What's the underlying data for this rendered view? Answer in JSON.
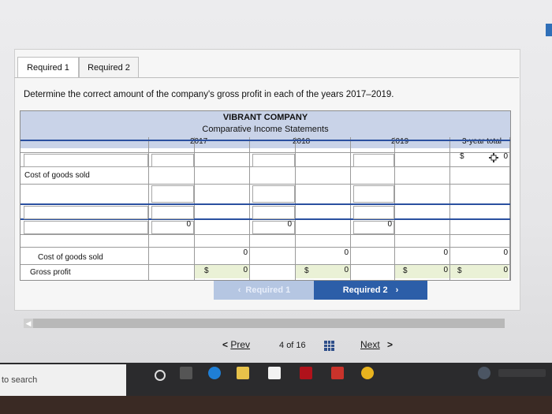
{
  "tabs": [
    {
      "label": "Required 1"
    },
    {
      "label": "Required 2"
    }
  ],
  "instruction": "Determine the correct amount of the company's gross profit in each of the years 2017–2019.",
  "statement": {
    "company": "VIBRANT COMPANY",
    "title": "Comparative Income Statements",
    "years": [
      "2017",
      "2018",
      "2019",
      "3-year total"
    ],
    "total_first_row": {
      "currency": "$",
      "value": "0"
    },
    "rows": {
      "cogs_label": "Cost of goods sold",
      "subtotals": [
        "0",
        "0",
        "0"
      ],
      "cogs_sub_label": "Cost of goods sold",
      "cogs_sub_values": [
        "0",
        "0",
        "0",
        "0"
      ],
      "gross_label": "Gross profit",
      "gross_currency": "$",
      "gross_values": [
        "0",
        "0",
        "0",
        "0"
      ]
    }
  },
  "buttons": {
    "prev_required": "Required 1",
    "next_required": "Required 2"
  },
  "pager": {
    "prev": "Prev",
    "page": "4",
    "of": "of 16",
    "next": "Next"
  },
  "taskbar": {
    "search_placeholder": "to search"
  },
  "colors": {
    "header_band": "#c9d3e8",
    "primary_button": "#2c5ea8",
    "gross_row": "#eaf1d6"
  }
}
